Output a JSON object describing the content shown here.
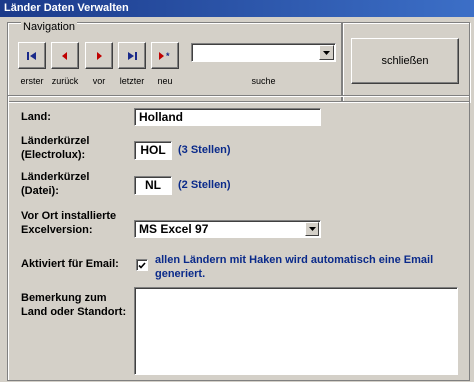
{
  "window": {
    "title": "Länder Daten Verwalten"
  },
  "navigation": {
    "group_label": "Navigation",
    "buttons": [
      {
        "label": "erster",
        "icon": "first-record-icon"
      },
      {
        "label": "zurück",
        "icon": "previous-record-icon"
      },
      {
        "label": "vor",
        "icon": "next-record-icon"
      },
      {
        "label": "letzter",
        "icon": "last-record-icon"
      },
      {
        "label": "neu",
        "icon": "new-record-icon"
      }
    ],
    "search": {
      "value": "",
      "label": "suche"
    }
  },
  "close_button": {
    "label": "schließen"
  },
  "form": {
    "land": {
      "label": "Land:",
      "value": "Holland"
    },
    "kuerzel_electrolux": {
      "label_line1": "Länderkürzel",
      "label_line2": "(Electrolux):",
      "value": "HOL",
      "hint": "(3 Stellen)"
    },
    "kuerzel_datei": {
      "label_line1": "Länderkürzel",
      "label_line2": "(Datei):",
      "value": "NL",
      "hint": "(2 Stellen)"
    },
    "excel_version": {
      "label_line1": "Vor Ort installierte",
      "label_line2": "Excelversion:",
      "value": "MS Excel 97"
    },
    "email": {
      "label": "Aktiviert für Email:",
      "checked": true,
      "description": "allen Ländern mit Haken wird automatisch eine Email generiert."
    },
    "bemerkung": {
      "label_line1": "Bemerkung zum",
      "label_line2": "Land oder Standort:",
      "value": ""
    }
  },
  "colors": {
    "title_bar": "#1b3a8a",
    "hint_text": "#0a2a8a",
    "nav_arrow": "#c00000"
  }
}
